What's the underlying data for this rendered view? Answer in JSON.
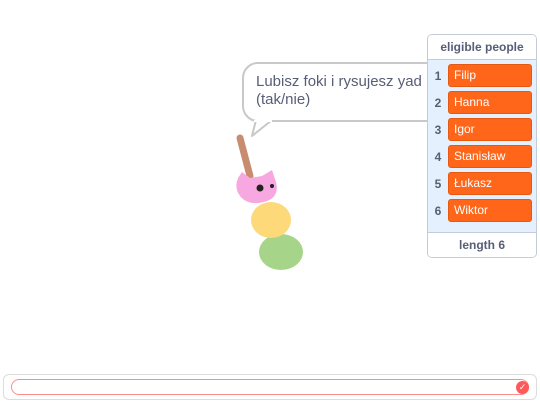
{
  "speech_bubble": {
    "line1": "Lubisz foki i rysujesz yad",
    "line2": "(tak/nie)"
  },
  "list_monitor": {
    "title": "eligible people",
    "items": [
      {
        "index": "1",
        "value": "Filip"
      },
      {
        "index": "2",
        "value": "Hanna"
      },
      {
        "index": "3",
        "value": "Igor"
      },
      {
        "index": "4",
        "value": "Stanisław"
      },
      {
        "index": "5",
        "value": "Łukasz"
      },
      {
        "index": "6",
        "value": "Wiktor"
      }
    ],
    "length_label": "length 6"
  },
  "answer_prompt": {
    "value": "",
    "submit_icon": "check-icon"
  },
  "colors": {
    "list_item": "#ff661a",
    "monitor_bg": "#e5f0ff",
    "text": "#575e75",
    "sprite_pink": "#f7a8e0",
    "sprite_yellow": "#fdd97a",
    "sprite_green": "#a6d58a",
    "stick": "#d39b7f"
  }
}
